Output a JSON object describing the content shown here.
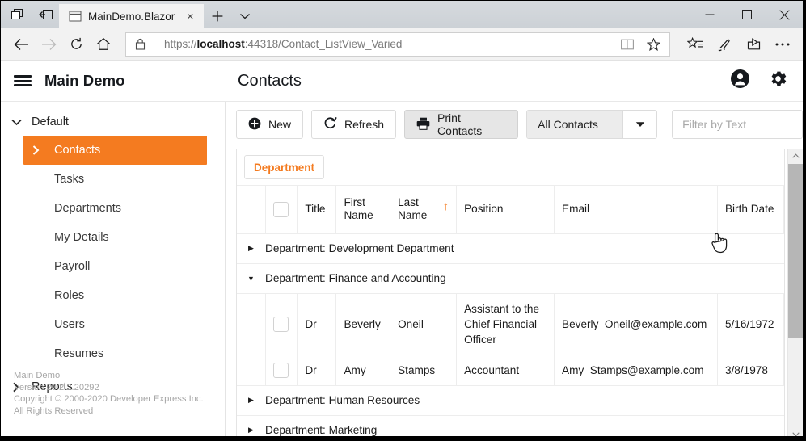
{
  "browser": {
    "tab": {
      "title": "MainDemo.Blazor",
      "close_label": "×"
    },
    "new_tab_label": "+",
    "tab_menu_label": "⌄",
    "window_controls": {
      "minimize": "—",
      "maximize": "□",
      "close": "✕"
    },
    "url": {
      "scheme": "https://",
      "host": "localhost",
      "rest": ":44318/Contact_ListView_Varied"
    },
    "icons": {
      "back": "back-arrow-icon",
      "forward": "forward-arrow-icon",
      "refresh": "refresh-icon",
      "home": "home-icon",
      "lock": "lock-icon",
      "reading_view": "book-icon",
      "favorite": "star-icon",
      "favorites_list": "star-list-icon",
      "notes": "pen-icon",
      "share": "share-icon",
      "more": "ellipsis-icon"
    }
  },
  "app": {
    "brand": "Main Demo",
    "page_title": "Contacts",
    "menu_icon": "hamburger-icon",
    "account_icon": "person-icon",
    "settings_icon": "gear-icon"
  },
  "sidebar": {
    "groups": [
      {
        "label": "Default",
        "expanded": true,
        "items": [
          {
            "label": "Contacts",
            "active": true
          },
          {
            "label": "Tasks",
            "active": false
          },
          {
            "label": "Departments",
            "active": false
          },
          {
            "label": "My Details",
            "active": false
          },
          {
            "label": "Payroll",
            "active": false
          },
          {
            "label": "Roles",
            "active": false
          },
          {
            "label": "Users",
            "active": false
          },
          {
            "label": "Resumes",
            "active": false
          }
        ]
      },
      {
        "label": "Reports",
        "expanded": false,
        "items": []
      }
    ],
    "footer": {
      "line1": "Main Demo",
      "line2": "Version 20.2.2.20292",
      "line3": "Copyright © 2000-2020 Developer Express Inc.",
      "line4": "All Rights Reserved"
    }
  },
  "toolbar": {
    "new_label": "New",
    "refresh_label": "Refresh",
    "print_label": "Print Contacts",
    "view_selector_value": "All Contacts",
    "filter_placeholder": "Filter by Text",
    "filter_value": "",
    "icons": {
      "new": "plus-circle-icon",
      "refresh": "refresh-circle-icon",
      "print": "printer-icon",
      "dropdown": "chevron-down-icon",
      "search": "magnifier-icon"
    }
  },
  "grid": {
    "group_chip": "Department",
    "columns": [
      {
        "key": "indicator",
        "label": ""
      },
      {
        "key": "select",
        "label": ""
      },
      {
        "key": "title",
        "label": "Title"
      },
      {
        "key": "first_name",
        "label": "First Name"
      },
      {
        "key": "last_name",
        "label": "Last Name",
        "sort": "asc"
      },
      {
        "key": "position",
        "label": "Position"
      },
      {
        "key": "email",
        "label": "Email"
      },
      {
        "key": "birth_date",
        "label": "Birth Date"
      }
    ],
    "groups": [
      {
        "label": "Department: Development Department",
        "expanded": false,
        "rows": []
      },
      {
        "label": "Department: Finance and Accounting",
        "expanded": true,
        "rows": [
          {
            "title": "Dr",
            "first_name": "Beverly",
            "last_name": "Oneil",
            "position": "Assistant to the Chief Financial Officer",
            "email": "Beverly_Oneil@example.com",
            "birth_date": "5/16/1972"
          },
          {
            "title": "Dr",
            "first_name": "Amy",
            "last_name": "Stamps",
            "position": "Accountant",
            "email": "Amy_Stamps@example.com",
            "birth_date": "3/8/1978"
          }
        ]
      },
      {
        "label": "Department: Human Resources",
        "expanded": false,
        "rows": []
      },
      {
        "label": "Department: Marketing",
        "expanded": false,
        "rows": []
      }
    ]
  },
  "colors": {
    "accent": "#F47B20",
    "text": "#1c1c1c",
    "muted": "#a6a6a6",
    "border": "#e4e4e4"
  }
}
